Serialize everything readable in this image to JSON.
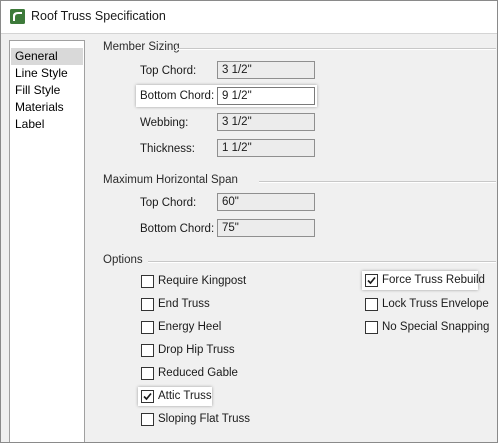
{
  "window": {
    "title": "Roof Truss Specification"
  },
  "nav": {
    "items": [
      {
        "label": "General",
        "selected": true
      },
      {
        "label": "Line Style",
        "selected": false
      },
      {
        "label": "Fill Style",
        "selected": false
      },
      {
        "label": "Materials",
        "selected": false
      },
      {
        "label": "Label",
        "selected": false
      }
    ]
  },
  "member_sizing": {
    "title": "Member Sizing",
    "top_chord": {
      "label": "Top Chord:",
      "value": "3 1/2\""
    },
    "bottom_chord": {
      "label": "Bottom Chord:",
      "value": "9 1/2\""
    },
    "webbing": {
      "label": "Webbing:",
      "value": "3 1/2\""
    },
    "thickness": {
      "label": "Thickness:",
      "value": "1 1/2\""
    }
  },
  "max_span": {
    "title": "Maximum Horizontal Span",
    "top_chord": {
      "label": "Top Chord:",
      "value": "60\""
    },
    "bottom_chord": {
      "label": "Bottom Chord:",
      "value": "75\""
    }
  },
  "options": {
    "title": "Options",
    "left": [
      {
        "label": "Require Kingpost",
        "checked": false
      },
      {
        "label": "End Truss",
        "checked": false
      },
      {
        "label": "Energy Heel",
        "checked": false
      },
      {
        "label": "Drop Hip Truss",
        "checked": false
      },
      {
        "label": "Reduced Gable",
        "checked": false
      },
      {
        "label": "Attic Truss",
        "checked": true
      },
      {
        "label": "Sloping Flat Truss",
        "checked": false
      }
    ],
    "right": [
      {
        "label": "Force Truss Rebuild",
        "checked": true
      },
      {
        "label": "Lock Truss Envelope",
        "checked": false
      },
      {
        "label": "No Special Snapping",
        "checked": false
      }
    ]
  },
  "colors": {
    "app_icon_green": "#3d7a3a",
    "selected_nav": "#d9d9d9",
    "dialog_bg": "#f0f0f0"
  },
  "icons": {
    "app": "chief-architect-icon",
    "check": "checkmark-icon"
  }
}
